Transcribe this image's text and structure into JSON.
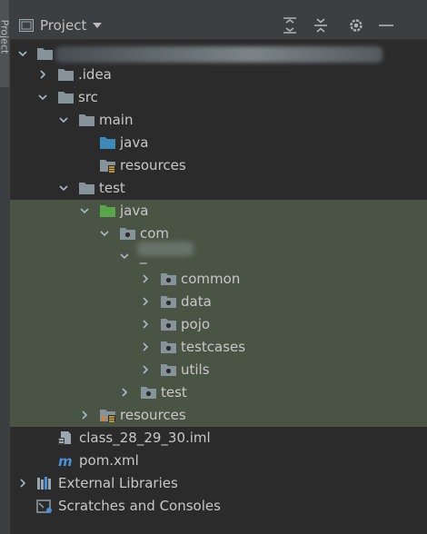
{
  "panel": {
    "side_tab_label": "Project",
    "title": "Project"
  },
  "tree": {
    "root_label": "",
    "items": [
      {
        "label": ".idea"
      },
      {
        "label": "src"
      },
      {
        "label": "main"
      },
      {
        "label": "java"
      },
      {
        "label": "resources"
      },
      {
        "label": "test"
      },
      {
        "label": "java"
      },
      {
        "label": "com"
      },
      {
        "label": "_"
      },
      {
        "label": "common"
      },
      {
        "label": "data"
      },
      {
        "label": "pojo"
      },
      {
        "label": "testcases"
      },
      {
        "label": "utils"
      },
      {
        "label": "test"
      },
      {
        "label": "resources"
      },
      {
        "label": "class_28_29_30.iml"
      },
      {
        "label": "pom.xml"
      },
      {
        "label": "External Libraries"
      },
      {
        "label": "Scratches and Consoles"
      }
    ]
  },
  "colors": {
    "background": "#2b2b2b",
    "header": "#3c3f41",
    "selection": "#4a5445",
    "folder": "#87939a",
    "source_folder": "#3d8ab8",
    "test_folder": "#5aa64a"
  }
}
